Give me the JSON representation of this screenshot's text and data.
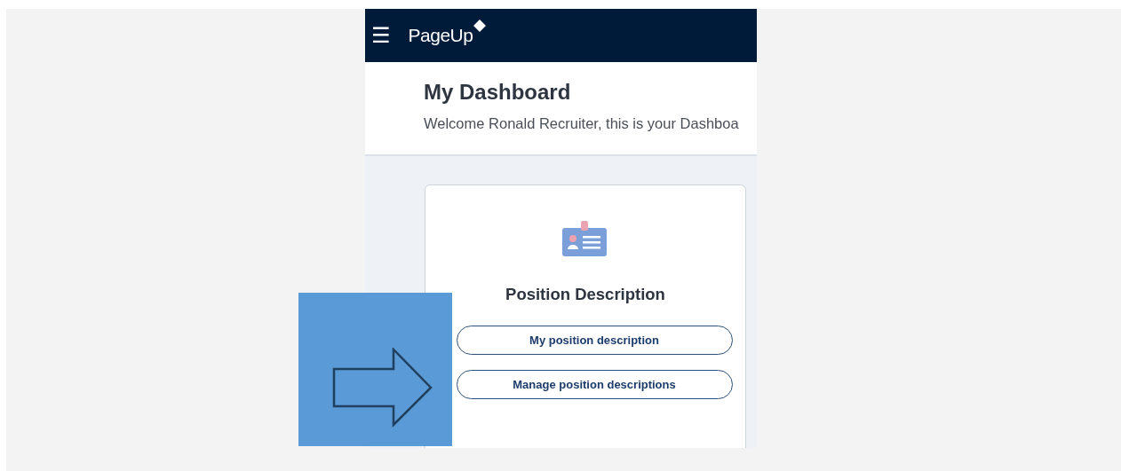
{
  "header": {
    "menu_icon": "☰",
    "logo": "PageUp"
  },
  "dashboard": {
    "title": "My Dashboard",
    "welcome": "Welcome Ronald Recruiter, this is your Dashboa"
  },
  "card": {
    "title": "Position Description",
    "buttons": [
      "My position description",
      "Manage position descriptions"
    ]
  }
}
